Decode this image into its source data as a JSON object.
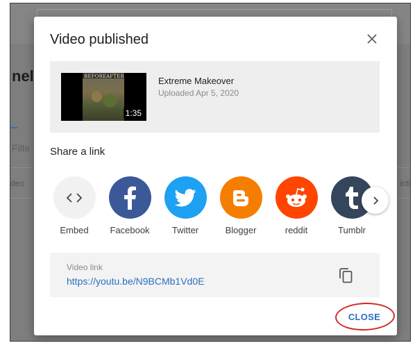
{
  "dialog": {
    "title": "Video published",
    "close_icon": "close-icon"
  },
  "background": {
    "heading_fragment": "nel",
    "filter_fragment": "Filte",
    "col_left_fragment": "deo",
    "col_right_fragment": "icti"
  },
  "video": {
    "title": "Extreme Makeover",
    "uploaded": "Uploaded Apr 5, 2020",
    "duration": "1:35",
    "thumb_left_text": "BEFORE",
    "thumb_right_text": "AFTER"
  },
  "share": {
    "heading": "Share a link",
    "items": [
      {
        "label": "Embed",
        "icon": "embed-icon",
        "color": "#f1f1f1"
      },
      {
        "label": "Facebook",
        "icon": "facebook-icon",
        "color": "#3b5998"
      },
      {
        "label": "Twitter",
        "icon": "twitter-icon",
        "color": "#1da1f2"
      },
      {
        "label": "Blogger",
        "icon": "blogger-icon",
        "color": "#f57d00"
      },
      {
        "label": "reddit",
        "icon": "reddit-icon",
        "color": "#ff4500"
      },
      {
        "label": "Tumblr",
        "icon": "tumblr-icon",
        "color": "#35465c"
      }
    ],
    "next_icon": "chevron-right-icon"
  },
  "link": {
    "label": "Video link",
    "url": "https://youtu.be/N9BCMb1Vd0E",
    "copy_icon": "copy-icon"
  },
  "actions": {
    "close_label": "CLOSE"
  },
  "colors": {
    "accent": "#2a6fc0",
    "highlight": "#d22a2a"
  }
}
